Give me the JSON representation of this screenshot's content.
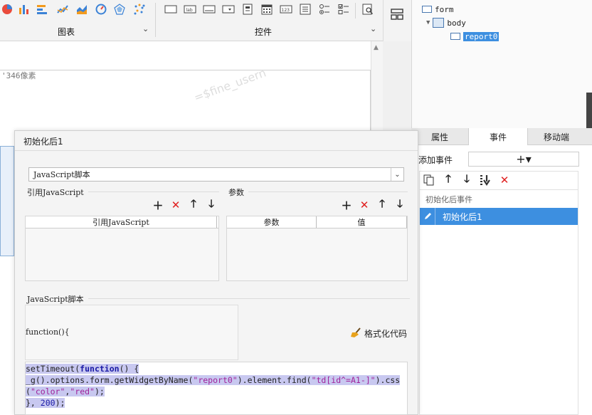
{
  "toolbar": {
    "chart_group_label": "图表",
    "widget_group_label": "控件",
    "chart_icons": [
      "pie-chart-icon",
      "bar-chart-icon",
      "horizontal-bar-icon",
      "line-chart-icon",
      "area-chart-icon",
      "gauge-icon",
      "radar-icon",
      "scatter-icon"
    ],
    "widget_icons": [
      "button-widget-icon",
      "label-widget-icon",
      "textbox-widget-icon",
      "combobox-widget-icon",
      "file-widget-icon",
      "date-widget-icon",
      "number-widget-icon",
      "list-widget-icon",
      "radio-group-icon",
      "checkbox-group-icon",
      "search-widget-icon"
    ],
    "icon_label_lab": "lab",
    "icon_label_num": "123",
    "layout_icon": "layout-icon"
  },
  "canvas": {
    "size_text": "'346像素",
    "watermark": "=$fine_usern"
  },
  "tree": {
    "root": "form",
    "body": "body",
    "selected": "report0"
  },
  "right_tabs": [
    "属性",
    "事件",
    "移动端"
  ],
  "events": {
    "add_label": "添加事件",
    "add_btn": "+▾",
    "header": "初始化后事件",
    "item": "初始化后1"
  },
  "dialog": {
    "title": "初始化后1",
    "type_select": "JavaScript脚本",
    "ref_js_label": "引用JavaScript",
    "params_label": "参数",
    "ref_js_col": "引用JavaScript",
    "param_col": "参数",
    "value_col": "值",
    "script_label": "JavaScript脚本",
    "fn_signature": "function(){",
    "format_btn": "格式化代码"
  },
  "code": {
    "l1_pre": "setTimeout(",
    "l1_kw": "function",
    "l1_post": "() {",
    "l2_a": "_g().options.form.getWidgetByName(",
    "l2_s1": "\"report0\"",
    "l2_b": ").element.find(",
    "l2_s2": "\"td[id^=A1-]\"",
    "l2_c": ").css",
    "l3_a": "(",
    "l3_s1": "\"color\"",
    "l3_b": ",",
    "l3_s2": "\"red\"",
    "l3_c": ");",
    "l4_a": "}, ",
    "l4_n": "200",
    "l4_b": ");"
  },
  "colors": {
    "selection": "#3d8fe0",
    "delete_red": "#e02020",
    "accent_blue": "#2e7bd6"
  }
}
